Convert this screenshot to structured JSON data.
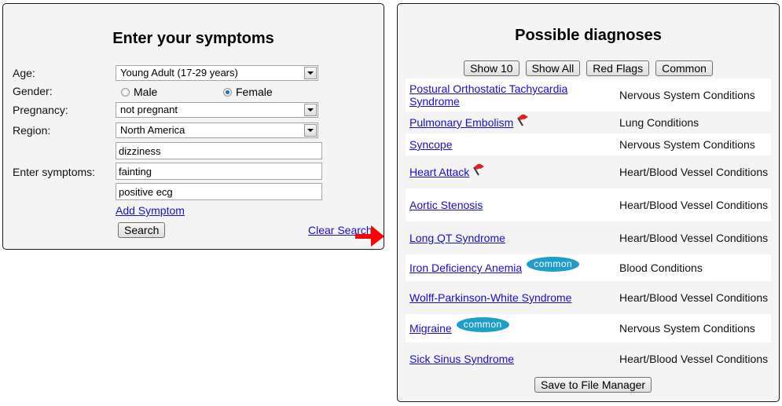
{
  "symptom_form": {
    "title": "Enter your symptoms",
    "age": {
      "label": "Age:",
      "value": "Young Adult (17-29 years)"
    },
    "gender": {
      "label": "Gender:",
      "options": [
        {
          "label": "Male",
          "selected": false
        },
        {
          "label": "Female",
          "selected": true
        }
      ]
    },
    "pregnancy": {
      "label": "Pregnancy:",
      "value": "not pregnant"
    },
    "region": {
      "label": "Region:",
      "value": "North America"
    },
    "symptoms": {
      "label": "Enter symptoms:",
      "values": [
        "dizziness",
        "fainting",
        "positive ecg"
      ]
    },
    "add_symptom_label": "Add Symptom",
    "search_label": "Search",
    "clear_search_label": "Clear Search"
  },
  "diagnoses": {
    "title": "Possible diagnoses",
    "filters": [
      "Show 10",
      "Show All",
      "Red Flags",
      "Common"
    ],
    "accent_colors": {
      "link": "#1a0dcc",
      "common_badge": "#1d9fc9",
      "red_flag": "#e02020",
      "arrow": "#ff0000"
    },
    "rows": [
      {
        "name": "Postural Orthostatic Tachycardia Syndrome",
        "category": "Nervous System Conditions",
        "red_flag": false,
        "common": false
      },
      {
        "name": "Pulmonary Embolism",
        "category": "Lung Conditions",
        "red_flag": true,
        "common": false
      },
      {
        "name": "Syncope",
        "category": "Nervous System Conditions",
        "red_flag": false,
        "common": false
      },
      {
        "name": "Heart Attack",
        "category": "Heart/Blood Vessel Conditions",
        "red_flag": true,
        "common": false
      },
      {
        "name": "Aortic Stenosis",
        "category": "Heart/Blood Vessel Conditions",
        "red_flag": false,
        "common": false
      },
      {
        "name": "Long QT Syndrome",
        "category": "Heart/Blood Vessel Conditions",
        "red_flag": false,
        "common": false
      },
      {
        "name": "Iron Deficiency Anemia",
        "category": "Blood Conditions",
        "red_flag": false,
        "common": true
      },
      {
        "name": "Wolff-Parkinson-White Syndrome",
        "category": "Heart/Blood Vessel Conditions",
        "red_flag": false,
        "common": false
      },
      {
        "name": "Migraine",
        "category": "Nervous System Conditions",
        "red_flag": false,
        "common": true
      },
      {
        "name": "Sick Sinus Syndrome",
        "category": "Heart/Blood Vessel Conditions",
        "red_flag": false,
        "common": false
      }
    ],
    "common_badge_label": "common",
    "save_label": "Save to File Manager"
  }
}
